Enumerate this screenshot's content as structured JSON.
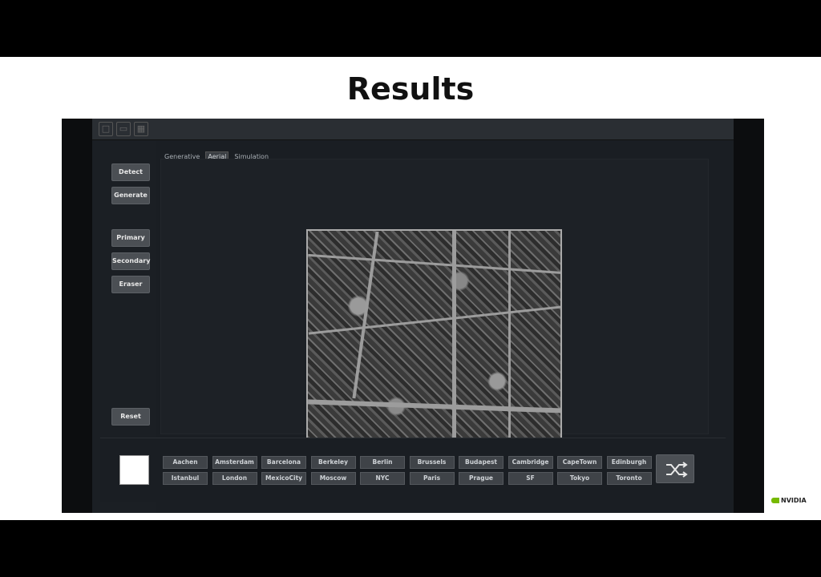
{
  "slide": {
    "title": "Results"
  },
  "app": {
    "sidebar": {
      "top_buttons": [
        "Detect",
        "Generate"
      ],
      "tool_buttons": [
        "Primary",
        "Secondary",
        "Eraser"
      ],
      "reset": "Reset"
    },
    "tabs": [
      {
        "label": "Generative",
        "active": false
      },
      {
        "label": "Aerial",
        "active": true
      },
      {
        "label": "Simulation",
        "active": false
      }
    ],
    "cities_row1": [
      "Aachen",
      "Amsterdam",
      "Barcelona",
      "Berkeley",
      "Berlin",
      "Brussels",
      "Budapest",
      "Cambridge",
      "CapeTown",
      "Edinburgh"
    ],
    "cities_row2": [
      "Istanbul",
      "London",
      "MexicoCity",
      "Moscow",
      "NYC",
      "Paris",
      "Prague",
      "SF",
      "Tokyo",
      "Toronto"
    ],
    "swatch_color": "#ffffff",
    "icons": [
      "new-file-icon",
      "open-folder-icon",
      "save-icon",
      "shuffle-icon"
    ]
  },
  "logo": {
    "text": "NVIDIA",
    "color": "#76b900"
  }
}
